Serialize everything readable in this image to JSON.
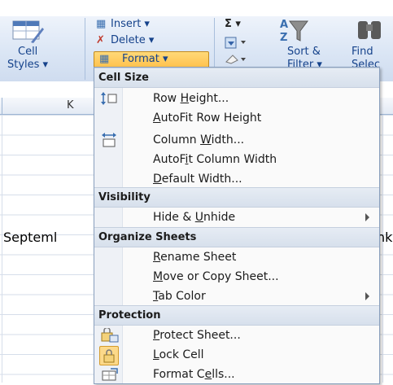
{
  "ribbon": {
    "cell_styles_line1": "Cell",
    "cell_styles_line2": "Styles ▾",
    "insert": "Insert ▾",
    "delete": "Delete ▾",
    "format": "Format ▾",
    "sigma": "Σ ▾",
    "sort_filter_line1": "Sort &",
    "sort_filter_line2": "Filter ▾",
    "find_line1": "Find",
    "find_line2": "Selec"
  },
  "grid": {
    "column_k": "K",
    "cell_text": "Septeml",
    "cell_text_right": "nkl"
  },
  "menu": {
    "cell_size_header": "Cell Size",
    "row_height": {
      "pre": "Row ",
      "u": "H",
      "post": "eight..."
    },
    "autofit_row_height": {
      "pre": "",
      "u": "A",
      "post": "utoFit Row Height"
    },
    "column_width": {
      "pre": "Column ",
      "u": "W",
      "post": "idth..."
    },
    "autofit_column_width": {
      "pre": "AutoF",
      "u": "i",
      "post": "t Column Width"
    },
    "default_width": {
      "pre": "",
      "u": "D",
      "post": "efault Width..."
    },
    "visibility_header": "Visibility",
    "hide_unhide": {
      "pre": "Hide & ",
      "u": "U",
      "post": "nhide"
    },
    "organize_header": "Organize Sheets",
    "rename_sheet": {
      "pre": "",
      "u": "R",
      "post": "ename Sheet"
    },
    "move_copy_sheet": {
      "pre": "",
      "u": "M",
      "post": "ove or Copy Sheet..."
    },
    "tab_color": {
      "pre": "",
      "u": "T",
      "post": "ab Color"
    },
    "protection_header": "Protection",
    "protect_sheet": {
      "pre": "",
      "u": "P",
      "post": "rotect Sheet..."
    },
    "lock_cell": {
      "pre": "",
      "u": "L",
      "post": "ock Cell"
    },
    "format_cells": {
      "pre": "Format C",
      "u": "e",
      "post": "lls..."
    }
  }
}
